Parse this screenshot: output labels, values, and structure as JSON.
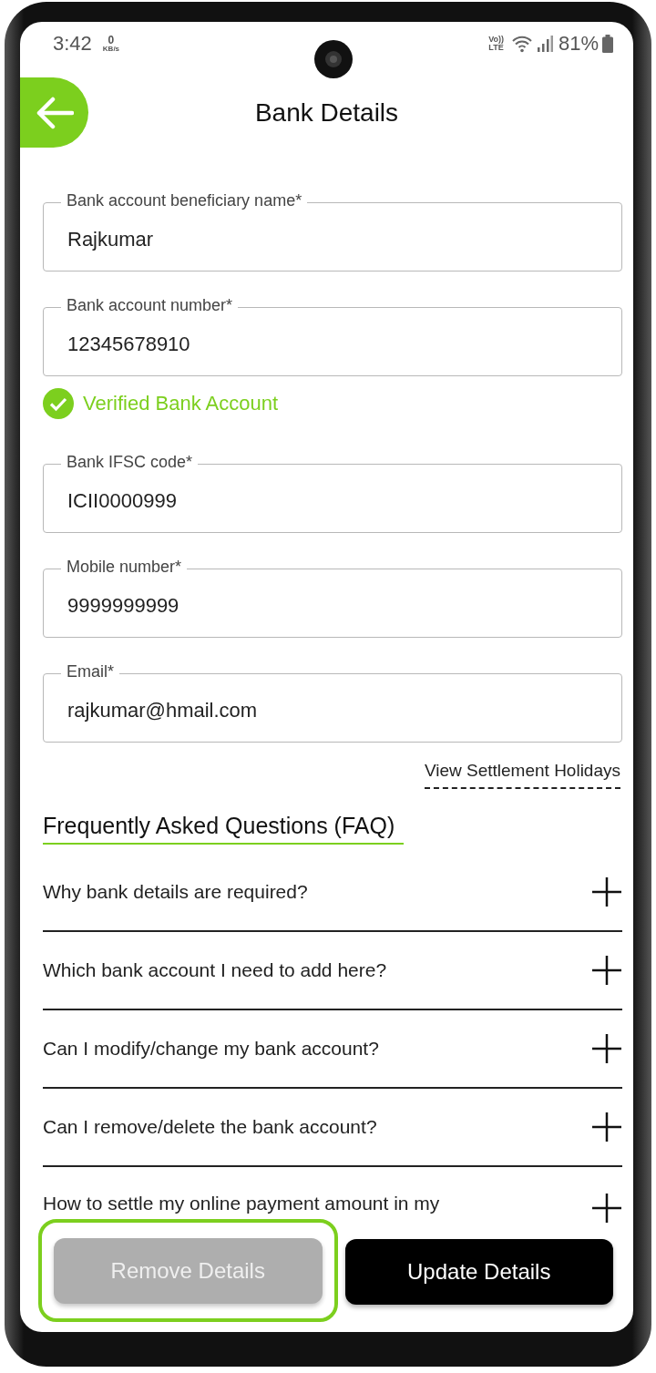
{
  "status_bar": {
    "time": "3:42",
    "data_rate_value": "0",
    "data_rate_unit": "KB/s",
    "volte_top": "Vo))",
    "volte_bottom": "LTE",
    "battery": "81%"
  },
  "header": {
    "title": "Bank Details"
  },
  "fields": [
    {
      "label": "Bank account beneficiary name*",
      "value": "Rajkumar"
    },
    {
      "label": "Bank account number*",
      "value": "12345678910",
      "note": "Verified Bank Account",
      "verified": true
    },
    {
      "label": "Bank IFSC code*",
      "value": "ICII0000999"
    },
    {
      "label": "Mobile number*",
      "value": "9999999999"
    },
    {
      "label": "Email*",
      "value": "rajkumar@hmail.com"
    }
  ],
  "settlement_link": "View Settlement Holidays",
  "faq": {
    "title": "Frequently Asked Questions (FAQ)",
    "items": [
      {
        "question": "Why bank details are required?",
        "expanded": false
      },
      {
        "question": "Which bank account I need to add here?",
        "expanded": false
      },
      {
        "question": "Can I modify/change my bank account?",
        "expanded": false
      },
      {
        "question": "Can I remove/delete the bank account?",
        "expanded": false
      },
      {
        "question": "How to settle my online payment amount in my",
        "expanded": false
      }
    ]
  },
  "buttons": [
    {
      "label": "Remove Details",
      "kind": "secondary",
      "disabled": true,
      "highlighted": true
    },
    {
      "label": "Update Details",
      "kind": "primary",
      "disabled": false,
      "highlighted": false
    }
  ]
}
